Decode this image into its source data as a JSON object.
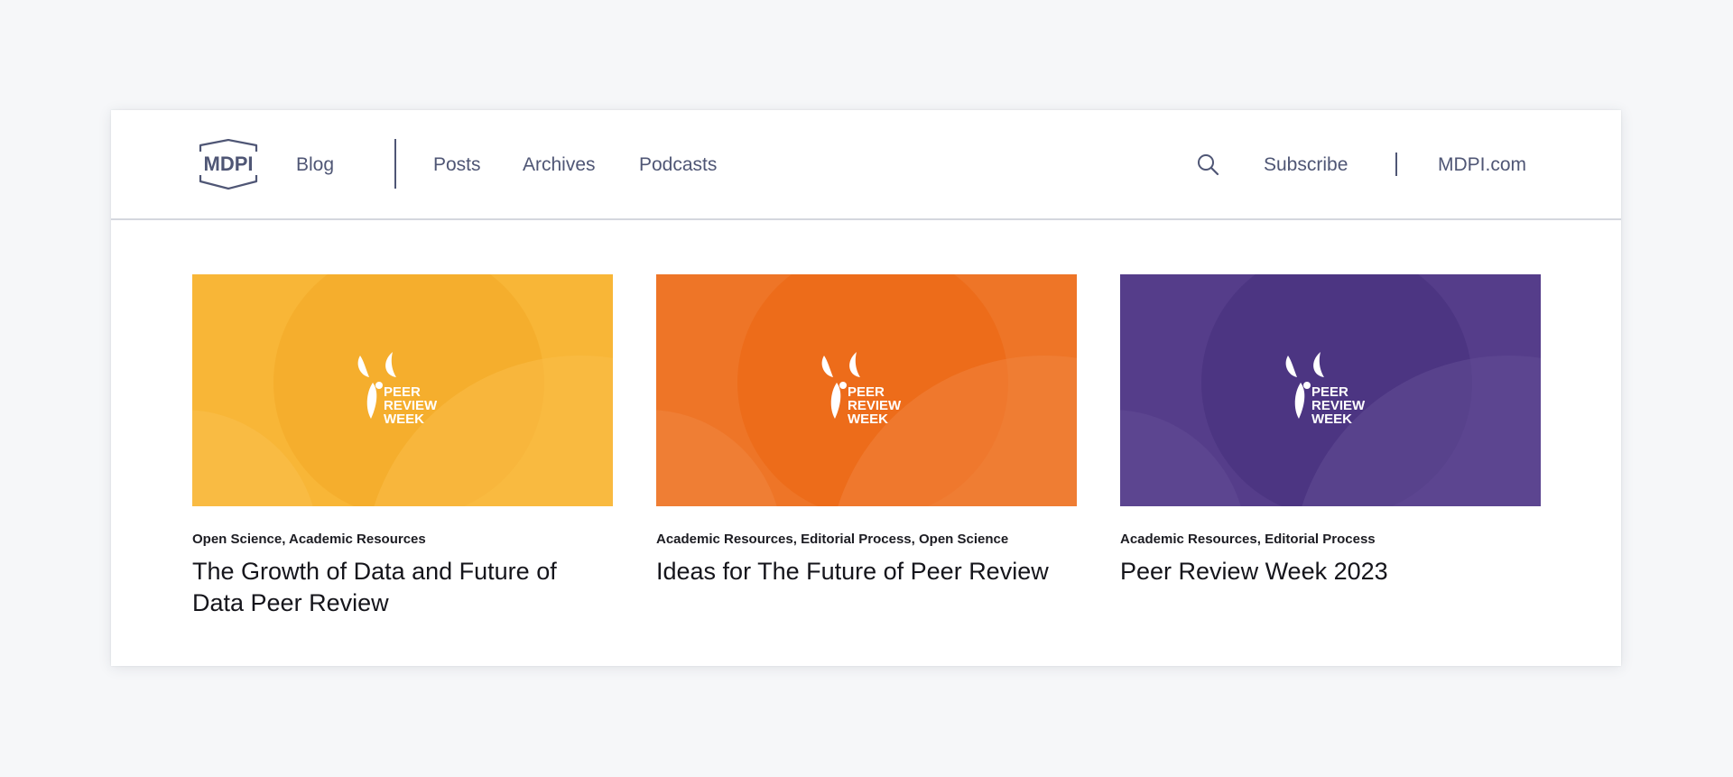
{
  "header": {
    "logo_text": "MDPI",
    "blog_label": "Blog",
    "nav": [
      "Posts",
      "Archives",
      "Podcasts"
    ],
    "subscribe_label": "Subscribe",
    "mdpi_link_label": "MDPI.com"
  },
  "posts": [
    {
      "categories": [
        "Open Science",
        "Academic Resources"
      ],
      "title": "The Growth of Data and Future of Data Peer Review",
      "thumb_text": [
        "PEER",
        "REVIEW",
        "WEEK"
      ],
      "color": "#f8b637"
    },
    {
      "categories": [
        "Academic Resources",
        "Editorial Process",
        "Open Science"
      ],
      "title": "Ideas for The Future of Peer Review",
      "thumb_text": [
        "PEER",
        "REVIEW",
        "WEEK"
      ],
      "color": "#ee7527"
    },
    {
      "categories": [
        "Academic Resources",
        "Editorial Process"
      ],
      "title": "Peer Review Week 2023",
      "thumb_text": [
        "PEER",
        "REVIEW",
        "WEEK"
      ],
      "color": "#553d8a"
    }
  ]
}
